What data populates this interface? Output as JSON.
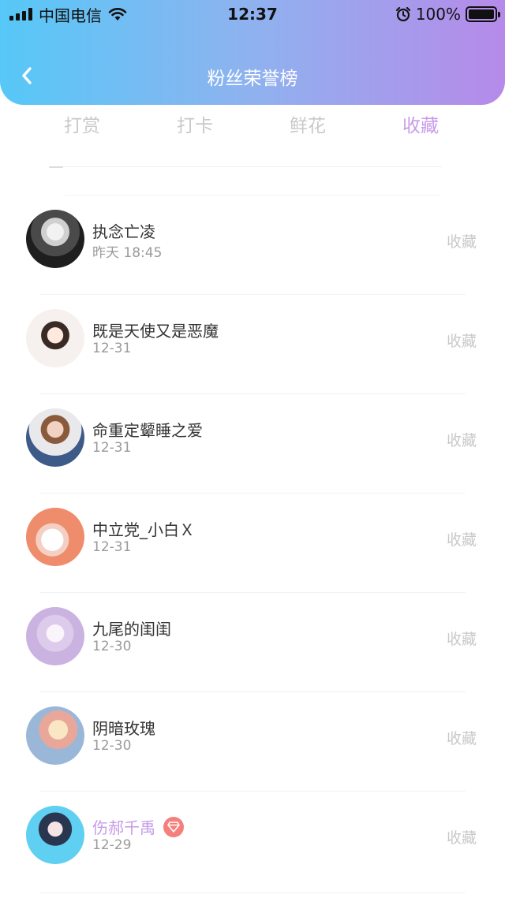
{
  "status_bar": {
    "carrier": "中国电信",
    "time": "12:37",
    "battery": "100%",
    "icons": [
      "signal-icon",
      "wifi-icon",
      "alarm-icon",
      "battery-icon"
    ]
  },
  "nav": {
    "title": "粉丝荣誉榜",
    "back_icon": "back-chevron-icon"
  },
  "tabs": [
    {
      "label": "打赏",
      "active": false
    },
    {
      "label": "打卡",
      "active": false
    },
    {
      "label": "鲜花",
      "active": false
    },
    {
      "label": "收藏",
      "active": true
    }
  ],
  "fans": [
    {
      "name": "执念亡凌",
      "date": "昨天 18:45",
      "action": "收藏"
    },
    {
      "name": "既是天使又是恶魔",
      "date": "12-31",
      "action": "收藏"
    },
    {
      "name": "命重定颦睡之爱",
      "date": "12-31",
      "action": "收藏"
    },
    {
      "name": "中立党_小白Ｘ",
      "date": "12-31",
      "action": "收藏"
    },
    {
      "name": "九尾的闺闺",
      "date": "12-30",
      "action": "收藏"
    },
    {
      "name": "阴暗玫瑰",
      "date": "12-30",
      "action": "收藏"
    },
    {
      "name": "伤郝千禹",
      "date": "12-29",
      "action": "收藏",
      "vip": true,
      "badge_icon": "diamond-icon"
    }
  ],
  "colors": {
    "header_gradient": [
      "#56c8f7",
      "#b68ae9"
    ],
    "active_tab": "#c79bea",
    "vip_name": "#c59be8",
    "badge": "#f57f7a"
  }
}
